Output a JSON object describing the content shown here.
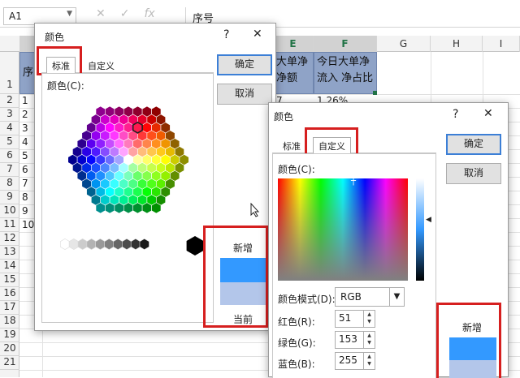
{
  "excel": {
    "name_box": "A1",
    "formula_content": "序号",
    "columns": [
      "E",
      "F",
      "G",
      "H",
      "I"
    ],
    "rows": [
      "1",
      "2",
      "3",
      "4",
      "5",
      "6",
      "7",
      "8",
      "9",
      "10",
      "11",
      "12",
      "13",
      "14",
      "15",
      "16",
      "17",
      "18",
      "19",
      "20",
      "21"
    ],
    "a_col_header": "序",
    "a_col_values": [
      "1",
      "2",
      "3",
      "4",
      "5",
      "6",
      "7",
      "8",
      "9",
      "10"
    ],
    "e1_text": "大单净 净额",
    "f1_text": "今日大单净 流入 净占比",
    "e2_value": "7",
    "f2_value": "1.26%"
  },
  "dialog_standard": {
    "title": "颜色",
    "help": "?",
    "close": "✕",
    "tab_standard": "标准",
    "tab_custom": "自定义",
    "colors_label": "颜色(C):",
    "ok": "确定",
    "cancel": "取消",
    "new_label": "新增",
    "current_label": "当前",
    "new_color": "#3399ff",
    "current_color": "#b3c6ea"
  },
  "dialog_custom": {
    "title": "颜色",
    "help": "?",
    "close": "✕",
    "tab_standard": "标准",
    "tab_custom": "自定义",
    "colors_label": "颜色(C):",
    "ok": "确定",
    "cancel": "取消",
    "color_model_label": "颜色模式(D):",
    "color_model_value": "RGB",
    "red_label": "红色(R):",
    "red_value": "51",
    "green_label": "绿色(G):",
    "green_value": "153",
    "blue_label": "蓝色(B):",
    "blue_value": "255",
    "new_label": "新增",
    "new_color": "#3399ff"
  }
}
